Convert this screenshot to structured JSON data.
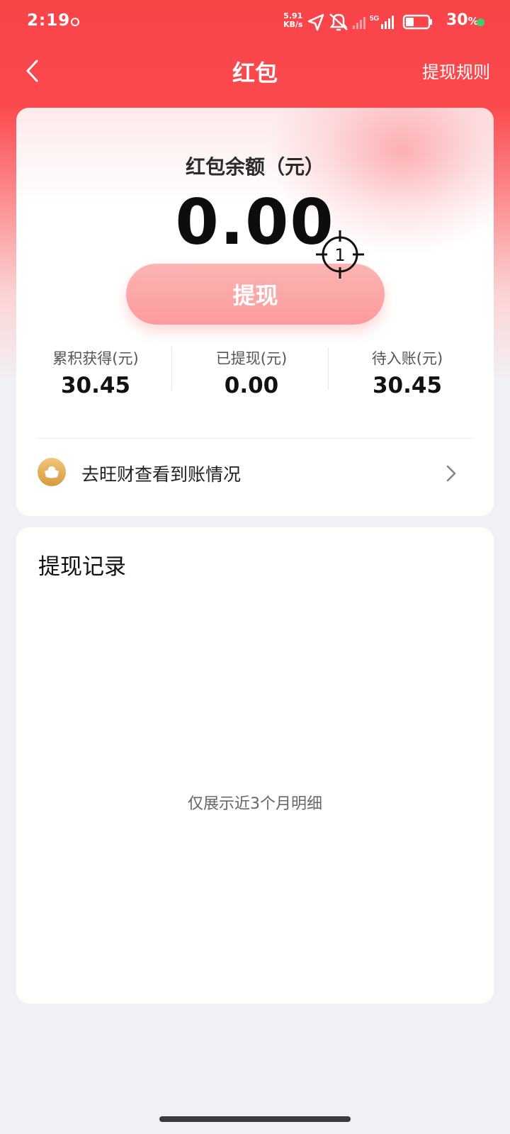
{
  "status_bar": {
    "time": "2:19",
    "net_speed_value": "5.91",
    "net_speed_unit": "KB/s",
    "network_type": "5G",
    "battery_percent": "30",
    "battery_suffix": "%"
  },
  "nav": {
    "title": "红包",
    "rules_label": "提现规则",
    "back_icon": "chevron-left-icon"
  },
  "balance_card": {
    "label": "红包余额（元）",
    "amount": "0.00",
    "withdraw_label": "提现",
    "stats": [
      {
        "label": "累积获得(元)",
        "value": "30.45"
      },
      {
        "label": "已提现(元)",
        "value": "0.00"
      },
      {
        "label": "待入账(元)",
        "value": "30.45"
      }
    ],
    "link_text": "去旺财查看到账情况",
    "link_icon": "coin-bowl-icon",
    "crosshair_marker": "1"
  },
  "records": {
    "title": "提现记录",
    "note": "仅展示近3个月明细"
  },
  "colors": {
    "brand_red": "#f94348",
    "button_pink": "#fca3a4",
    "background": "#f1f1f5",
    "status_green": "#3ed06a"
  }
}
